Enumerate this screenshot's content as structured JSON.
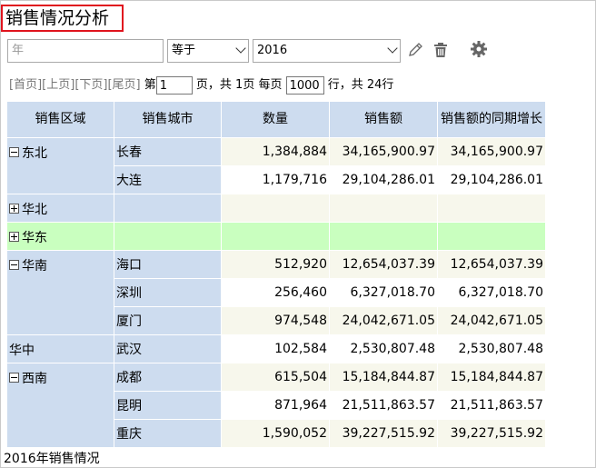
{
  "title": "销售情况分析",
  "filter": {
    "field_placeholder": "年",
    "operator": "等于",
    "value": "2016"
  },
  "icons": [
    "pencil-icon",
    "trash-icon",
    "gear-icon"
  ],
  "pager": {
    "first": "[首页]",
    "prev": "[上页]",
    "next": "[下页]",
    "last": "[尾页]",
    "page_prefix": "第",
    "page_value": "1",
    "page_suffix": "页，共 1页 每页",
    "per_page": "1000",
    "rows_suffix": "行，共 24行"
  },
  "table": {
    "columns": [
      "销售区域",
      "销售城市",
      "数量",
      "销售额",
      "销售额的同期增长"
    ],
    "groups": [
      {
        "region": "东北",
        "toggle": "minus",
        "rows": [
          {
            "city": "长春",
            "qty": "1,384,884",
            "sales": "34,165,900.97",
            "growth": "34,165,900.97"
          },
          {
            "city": "大连",
            "qty": "1,179,716",
            "sales": "29,104,286.01",
            "growth": "29,104,286.01"
          }
        ]
      },
      {
        "region": "华北",
        "toggle": "plus",
        "rows": [
          {
            "city": "",
            "qty": "",
            "sales": "",
            "growth": ""
          }
        ]
      },
      {
        "region": "华东",
        "toggle": "plus",
        "highlight": true,
        "rows": [
          {
            "city": "",
            "qty": "",
            "sales": "",
            "growth": ""
          }
        ]
      },
      {
        "region": "华南",
        "toggle": "minus",
        "rows": [
          {
            "city": "海口",
            "qty": "512,920",
            "sales": "12,654,037.39",
            "growth": "12,654,037.39"
          },
          {
            "city": "深圳",
            "qty": "256,460",
            "sales": "6,327,018.70",
            "growth": "6,327,018.70"
          },
          {
            "city": "厦门",
            "qty": "974,548",
            "sales": "24,042,671.05",
            "growth": "24,042,671.05"
          }
        ]
      },
      {
        "region": "华中",
        "toggle": "none",
        "rows": [
          {
            "city": "武汉",
            "qty": "102,584",
            "sales": "2,530,807.48",
            "growth": "2,530,807.48"
          }
        ]
      },
      {
        "region": "西南",
        "toggle": "minus",
        "rows": [
          {
            "city": "成都",
            "qty": "615,504",
            "sales": "15,184,844.87",
            "growth": "15,184,844.87"
          },
          {
            "city": "昆明",
            "qty": "871,964",
            "sales": "21,511,863.57",
            "growth": "21,511,863.57"
          },
          {
            "city": "重庆",
            "qty": "1,590,052",
            "sales": "39,227,515.92",
            "growth": "39,227,515.92"
          }
        ]
      }
    ]
  },
  "footer": "2016年销售情况",
  "colors": {
    "header_bg": "#cddcef",
    "highlight_row": "#c9ffbf",
    "title_border": "#e0141e"
  }
}
